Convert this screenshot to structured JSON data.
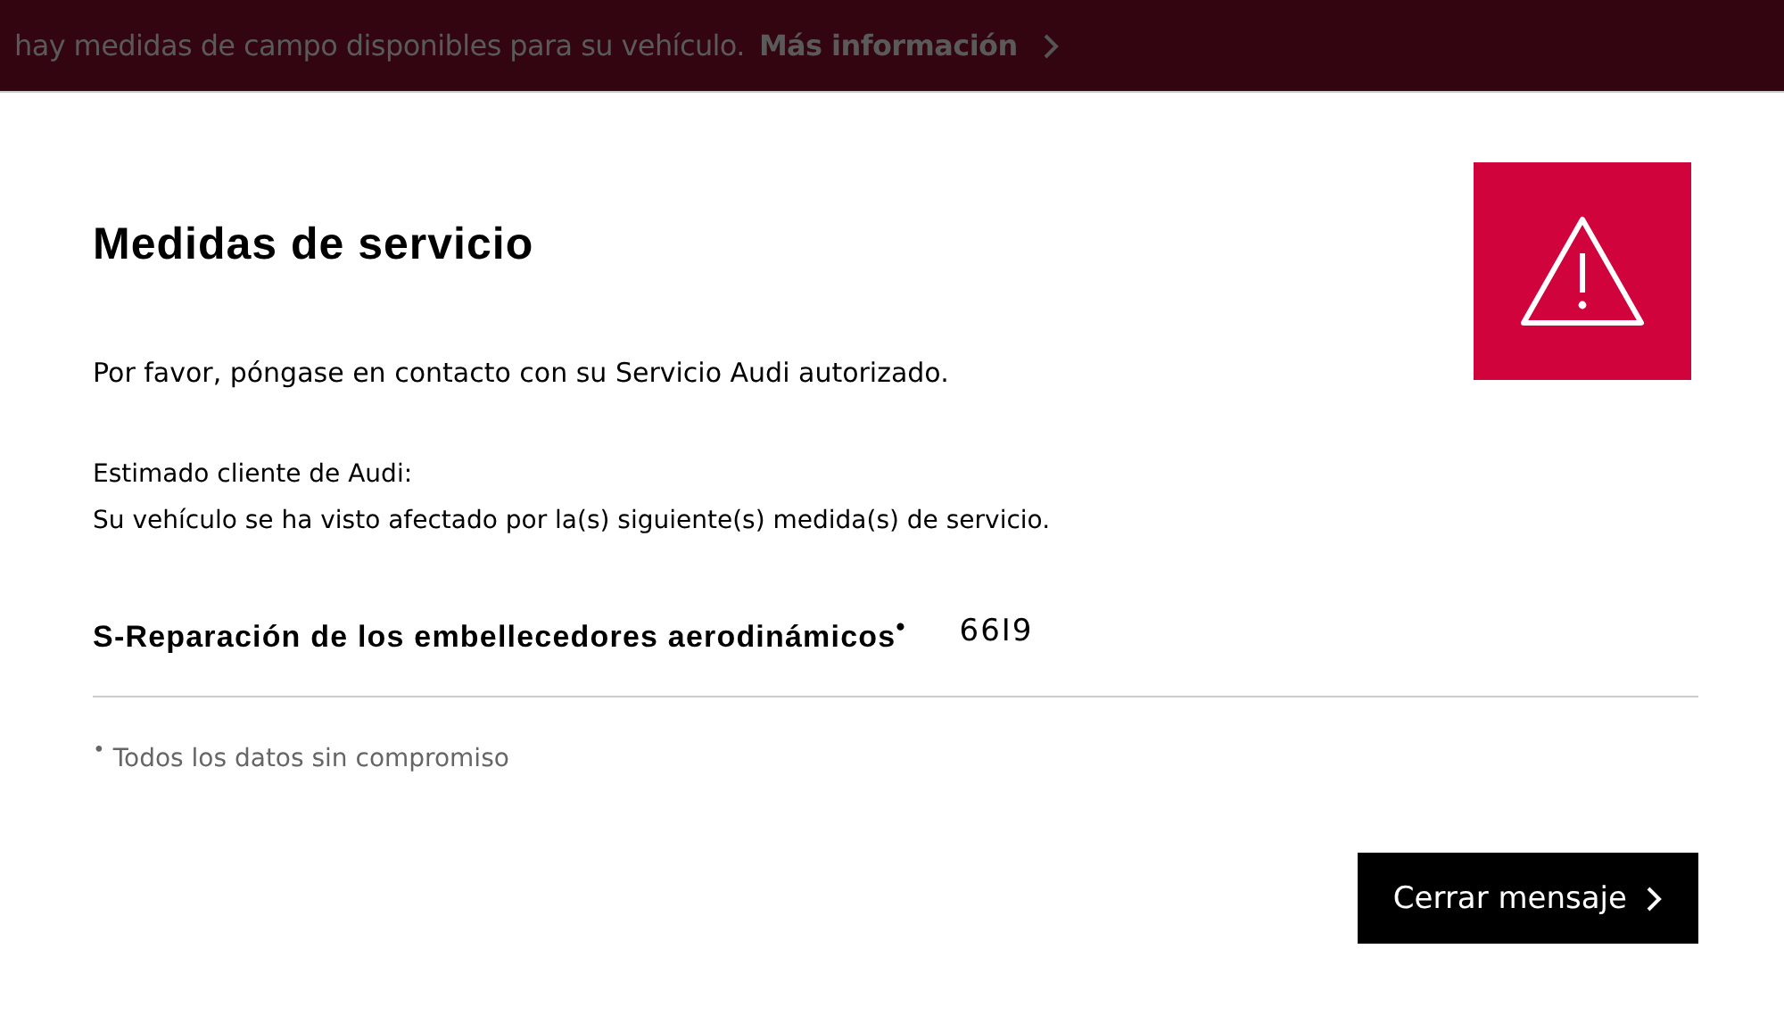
{
  "banner": {
    "text": "hay medidas de campo disponibles para su vehículo.",
    "link": "Más información"
  },
  "dialog": {
    "title": "Medidas de servicio",
    "intro": "Por favor, póngase en contacto con su Servicio Audi autorizado.",
    "greeting": "Estimado cliente de Audi:",
    "message": "Su vehículo se ha visto afectado por la(s) siguiente(s) medida(s) de servicio.",
    "measures": [
      {
        "name": "S-Reparación de los embellecedores aerodinámicos$^{•}$",
        "code": "66I9"
      }
    ],
    "footnote": "$^{•}$ Todos los datos sin compromiso",
    "button": "Cerrar mensaje"
  }
}
